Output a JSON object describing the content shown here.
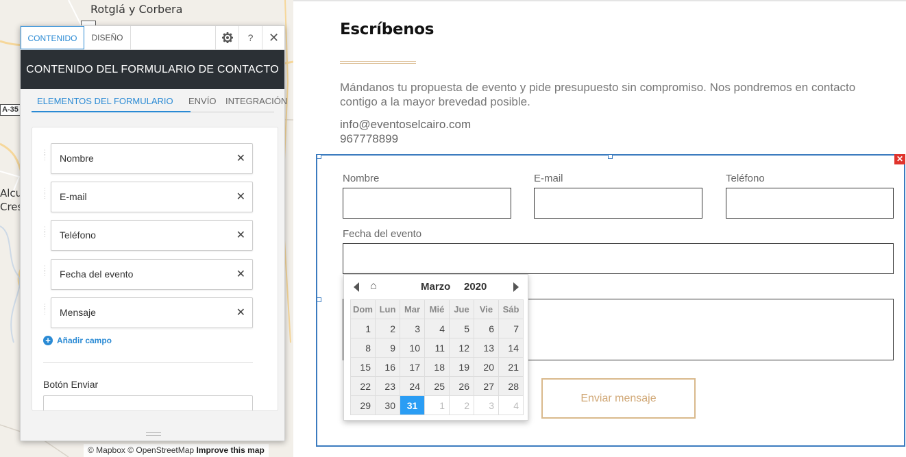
{
  "map": {
    "place_top": "Rotglá y Corbera",
    "place_left_line1": "Alcud",
    "place_left_line2": "Cres",
    "road": "A-35",
    "attribution_osm": "© Mapbox © OpenStreetMap",
    "attribution_improve": "Improve this map"
  },
  "editor": {
    "tabs": [
      "CONTENIDO",
      "DISEÑO"
    ],
    "icons": [
      "gear-icon",
      "help-icon",
      "close-icon"
    ],
    "help_glyph": "?",
    "close_glyph": "✕",
    "header": "CONTENIDO DEL FORMULARIO DE CONTACTO",
    "subtabs": [
      "ELEMENTOS DEL FORMULARIO",
      "ENVÍO",
      "INTEGRACIÓN"
    ],
    "fields": [
      "Nombre",
      "E-mail",
      "Teléfono",
      "Fecha del evento",
      "Mensaje"
    ],
    "remove_glyph": "✕",
    "add_field": "Añadir campo",
    "add_glyph": "+",
    "send_button_label": "Botón Enviar"
  },
  "page": {
    "title": "Escríbenos",
    "intro": "Mándanos tu propuesta de evento y pide presupuesto sin compromiso. Nos pondremos en contacto contigo a la mayor brevedad posible.",
    "email": "info@eventoselcairo.com",
    "phone": "967778899"
  },
  "form": {
    "close_glyph": "✕",
    "labels": {
      "name": "Nombre",
      "email": "E-mail",
      "phone": "Teléfono",
      "date": "Fecha del evento"
    },
    "submit": "Enviar mensaje"
  },
  "datepicker": {
    "home_glyph": "⌂",
    "month": "Marzo",
    "year": "2020",
    "weekdays": [
      "Dom",
      "Lun",
      "Mar",
      "Mié",
      "Jue",
      "Vie",
      "Sáb"
    ],
    "weeks": [
      [
        "1",
        "2",
        "3",
        "4",
        "5",
        "6",
        "7"
      ],
      [
        "8",
        "9",
        "10",
        "11",
        "12",
        "13",
        "14"
      ],
      [
        "15",
        "16",
        "17",
        "18",
        "19",
        "20",
        "21"
      ],
      [
        "22",
        "23",
        "24",
        "25",
        "26",
        "27",
        "28"
      ],
      [
        "29",
        "30",
        "31",
        "1",
        "2",
        "3",
        "4"
      ]
    ],
    "selected_day": "31"
  },
  "colors": {
    "accent": "#2a8ad4",
    "panel_header": "#2b3035",
    "frame": "#3b7bbf",
    "gold": "#d9b98c",
    "selected_day": "#2a9df4",
    "close_red": "#e0332c"
  }
}
